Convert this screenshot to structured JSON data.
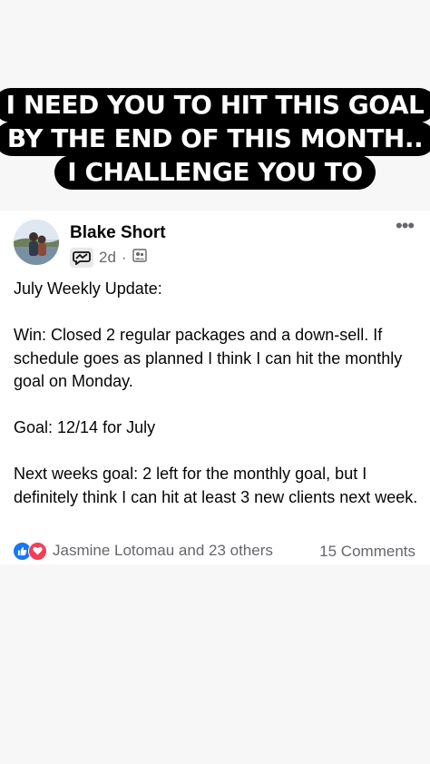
{
  "caption": {
    "lines": [
      "I NEED YOU TO HIT THIS GOAL",
      "BY THE END OF THIS MONTH..",
      "I CHALLENGE YOU TO"
    ]
  },
  "post": {
    "author": "Blake Short",
    "time": "2d",
    "separator": "·",
    "badge_icon": "chat-badge-icon",
    "audience_icon": "group-icon",
    "more_label": "•••",
    "body": [
      "July Weekly Update:",
      "",
      "Win: Closed 2 regular packages and a down-sell.  If schedule goes as planned I think I can hit the monthly goal on Monday.",
      "",
      "Goal: 12/14 for July",
      "",
      "Next weeks goal: 2 left for the monthly goal, but I definitely think I can hit at least 3 new clients next week."
    ],
    "reactions": {
      "icons": [
        "like-icon",
        "love-icon"
      ],
      "names": "Jasmine Lotomau and 23 others",
      "comments": "15 Comments"
    }
  },
  "colors": {
    "background": "#f7f7f7",
    "card": "#ffffff",
    "caption_bg": "#000000",
    "like_blue": "#1877f2",
    "love_red": "#f33e58",
    "meta_gray": "#65676b"
  }
}
